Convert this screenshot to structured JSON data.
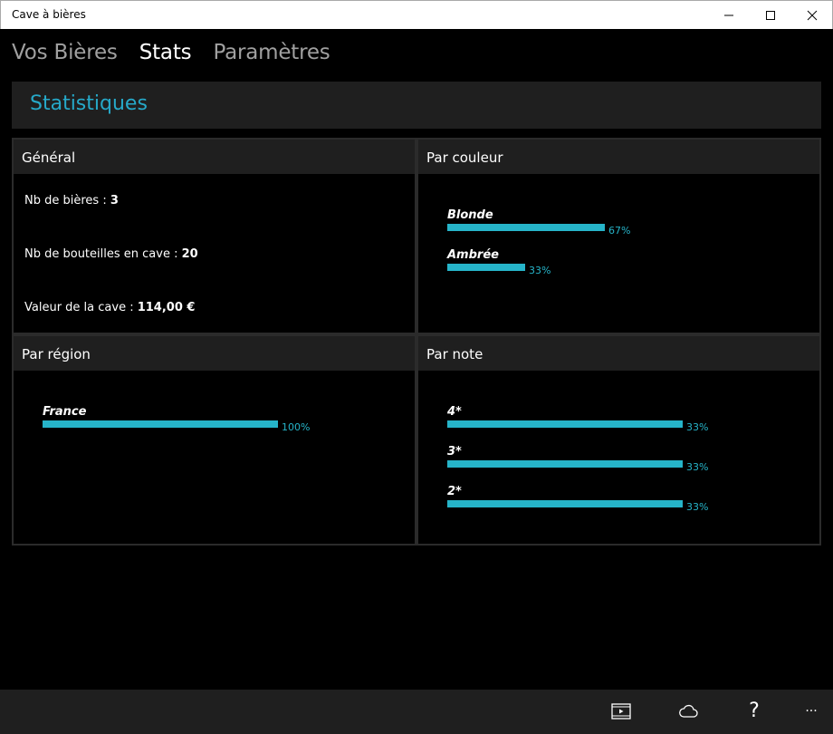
{
  "window": {
    "title": "Cave à bières"
  },
  "nav": {
    "tabs": [
      {
        "label": "Vos Bières",
        "active": false
      },
      {
        "label": "Stats",
        "active": true
      },
      {
        "label": "Paramètres",
        "active": false
      }
    ]
  },
  "header": {
    "title": "Statistiques"
  },
  "general": {
    "title": "Général",
    "beers_label": "Nb de bières : ",
    "beers_value": "3",
    "bottles_label": "Nb de bouteilles en cave : ",
    "bottles_value": "20",
    "value_label": "Valeur de la cave : ",
    "value_value": "114,00 €"
  },
  "colors": {
    "accent": "#26a9c9",
    "bar": "#26b4c9",
    "panel_header": "#1f1f1f",
    "background": "#000000"
  },
  "color_stats": {
    "title": "Par couleur",
    "items": [
      {
        "label": "Blonde",
        "fraction": 0.67,
        "pct": "67%"
      },
      {
        "label": "Ambrée",
        "fraction": 0.33,
        "pct": "33%"
      }
    ]
  },
  "region_stats": {
    "title": "Par région",
    "items": [
      {
        "label": "France",
        "fraction": 1.0,
        "pct": "100%"
      }
    ]
  },
  "rating_stats": {
    "title": "Par note",
    "items": [
      {
        "label": "4*",
        "fraction": 1.0,
        "pct": "33%"
      },
      {
        "label": "3*",
        "fraction": 1.0,
        "pct": "33%"
      },
      {
        "label": "2*",
        "fraction": 1.0,
        "pct": "33%"
      }
    ]
  },
  "command_bar": {
    "icons": [
      "slideshow-icon",
      "cloud-icon",
      "help-icon",
      "more-icon"
    ],
    "help_glyph": "?",
    "more_glyph": "···"
  }
}
